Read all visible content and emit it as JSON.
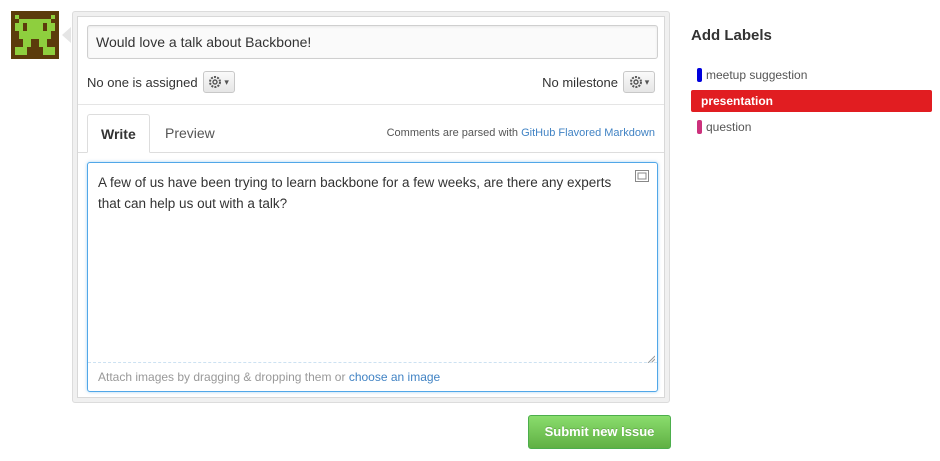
{
  "issue": {
    "title_value": "Would love a talk about Backbone!",
    "assignee_text": "No one is assigned",
    "milestone_text": "No milestone"
  },
  "editor": {
    "tabs": [
      {
        "label": "Write",
        "active": true
      },
      {
        "label": "Preview",
        "active": false
      }
    ],
    "markdown_note_prefix": "Comments are parsed with",
    "markdown_link": "GitHub Flavored Markdown",
    "comment_text": "A few of us have been trying to learn backbone for a few weeks, are there any experts that can help us out with a talk?",
    "attach_prefix": "Attach images by dragging & dropping them or",
    "attach_link": "choose an image"
  },
  "actions": {
    "submit_label": "Submit new Issue"
  },
  "labels": {
    "heading": "Add Labels",
    "items": [
      {
        "name": "meetup suggestion",
        "color": "#0000dd",
        "selected": false
      },
      {
        "name": "presentation",
        "color": "#e11d21",
        "selected": true
      },
      {
        "name": "question",
        "color": "#cc317c",
        "selected": false
      }
    ]
  },
  "icons": {
    "avatar": "pixel-avatar-icon",
    "assignee_gear": "gear-icon",
    "milestone_gear": "gear-icon",
    "fullscreen": "fullscreen-icon",
    "resize": "resize-handle-icon"
  }
}
